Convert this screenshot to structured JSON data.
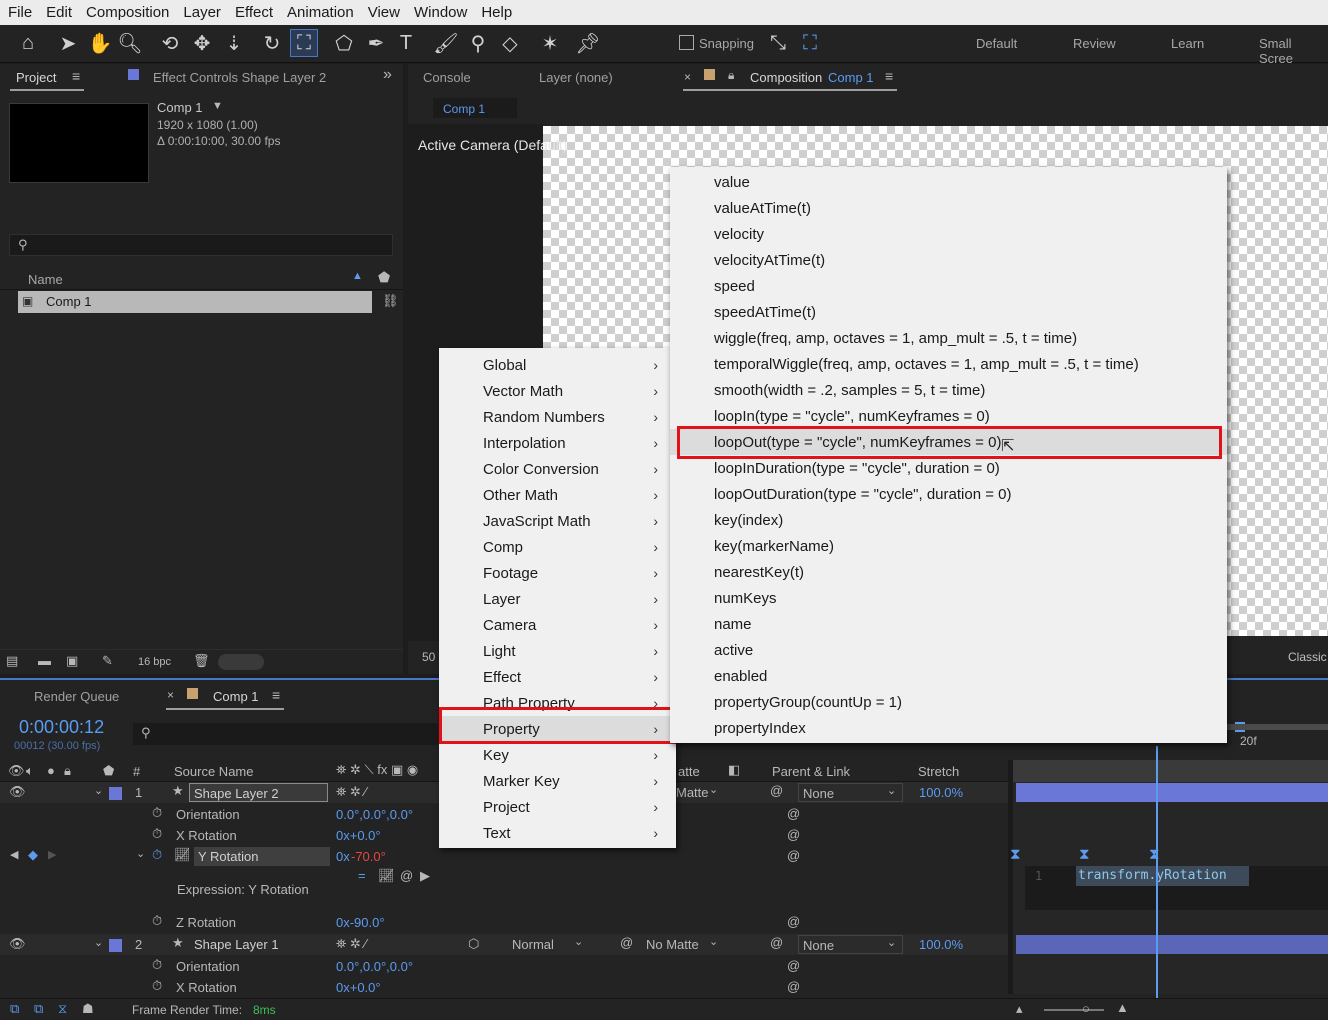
{
  "menubar": [
    "File",
    "Edit",
    "Composition",
    "Layer",
    "Effect",
    "Animation",
    "View",
    "Window",
    "Help"
  ],
  "toolbar": {
    "snapping_label": "Snapping",
    "workspaces": [
      "Default",
      "Review",
      "Learn",
      "Small Scree"
    ]
  },
  "project_panel": {
    "tab_project": "Project",
    "tab_effect_controls": "Effect Controls Shape Layer 2",
    "comp_name": "Comp 1",
    "comp_size": "1920 x 1080 (1.00)",
    "comp_duration": "Δ 0:00:10:00, 30.00 fps",
    "name_header": "Name",
    "items": [
      {
        "name": "Comp 1"
      }
    ],
    "bpc": "16 bpc"
  },
  "viewer": {
    "tab_console": "Console",
    "tab_layer": "Layer (none)",
    "tab_composition_label": "Composition",
    "tab_composition_name": "Comp 1",
    "breadcrumb": "Comp 1",
    "camera_label": "Active Camera (Default)",
    "zoom_partial": "50",
    "renderer": "Classic"
  },
  "context_menu": {
    "items": [
      {
        "label": "Global"
      },
      {
        "label": "Vector Math"
      },
      {
        "label": "Random Numbers"
      },
      {
        "label": "Interpolation"
      },
      {
        "label": "Color Conversion"
      },
      {
        "label": "Other Math"
      },
      {
        "label": "JavaScript Math"
      },
      {
        "label": "Comp"
      },
      {
        "label": "Footage"
      },
      {
        "label": "Layer"
      },
      {
        "label": "Camera"
      },
      {
        "label": "Light"
      },
      {
        "label": "Effect"
      },
      {
        "label": "Path Property"
      },
      {
        "label": "Property"
      },
      {
        "label": "Key"
      },
      {
        "label": "Marker Key"
      },
      {
        "label": "Project"
      },
      {
        "label": "Text"
      }
    ],
    "selected": "Property"
  },
  "submenu": {
    "items": [
      "value",
      "valueAtTime(t)",
      "velocity",
      "velocityAtTime(t)",
      "speed",
      "speedAtTime(t)",
      "wiggle(freq, amp, octaves = 1, amp_mult = .5, t = time)",
      "temporalWiggle(freq, amp, octaves = 1, amp_mult = .5, t = time)",
      "smooth(width = .2, samples = 5, t = time)",
      "loopIn(type = \"cycle\", numKeyframes = 0)",
      "loopOut(type = \"cycle\", numKeyframes = 0)",
      "loopInDuration(type = \"cycle\", duration = 0)",
      "loopOutDuration(type = \"cycle\", duration = 0)",
      "key(index)",
      "key(markerName)",
      "nearestKey(t)",
      "numKeys",
      "name",
      "active",
      "enabled",
      "propertyGroup(countUp = 1)",
      "propertyIndex"
    ],
    "selected": "loopOut(type = \"cycle\", numKeyframes = 0)"
  },
  "timeline": {
    "tab_render_queue": "Render Queue",
    "tab_comp": "Comp 1",
    "timecode": "0:00:00:12",
    "frame_info": "00012 (30.00 fps)",
    "col_number": "#",
    "col_source_name": "Source Name",
    "col_matte_partial": "atte",
    "col_parent": "Parent & Link",
    "col_stretch": "Stretch",
    "ruler_label": "20f",
    "layers": [
      {
        "num": "1",
        "name": "Shape Layer 2",
        "matte": "Matte",
        "parent": "None",
        "stretch": "100.0%"
      },
      {
        "num": "2",
        "name": "Shape Layer 1",
        "mode": "Normal",
        "matte": "No Matte",
        "parent": "None",
        "stretch": "100.0%"
      }
    ],
    "props1": [
      {
        "name": "Orientation",
        "value": "0.0°,0.0°,0.0°"
      },
      {
        "name": "X Rotation",
        "value": "0x+0.0°"
      },
      {
        "name": "Y Rotation",
        "value_prefix": "0x",
        "value_red": "-70.0°"
      },
      {
        "name": "Z Rotation",
        "value": "0x-90.0°"
      }
    ],
    "expression_label": "Expression: Y Rotation",
    "expression_line_num": "1",
    "expression_code": "transform.yRotation",
    "props2": [
      {
        "name": "Orientation",
        "value": "0.0°,0.0°,0.0°"
      },
      {
        "name": "X Rotation",
        "value": "0x+0.0°"
      }
    ],
    "frame_render_label": "Frame Render Time:",
    "frame_render_value": "8ms"
  },
  "colors": {
    "accent_blue": "#5b9bf0",
    "highlight_red": "#e0131b",
    "layer_bar": "#6a77d6"
  }
}
